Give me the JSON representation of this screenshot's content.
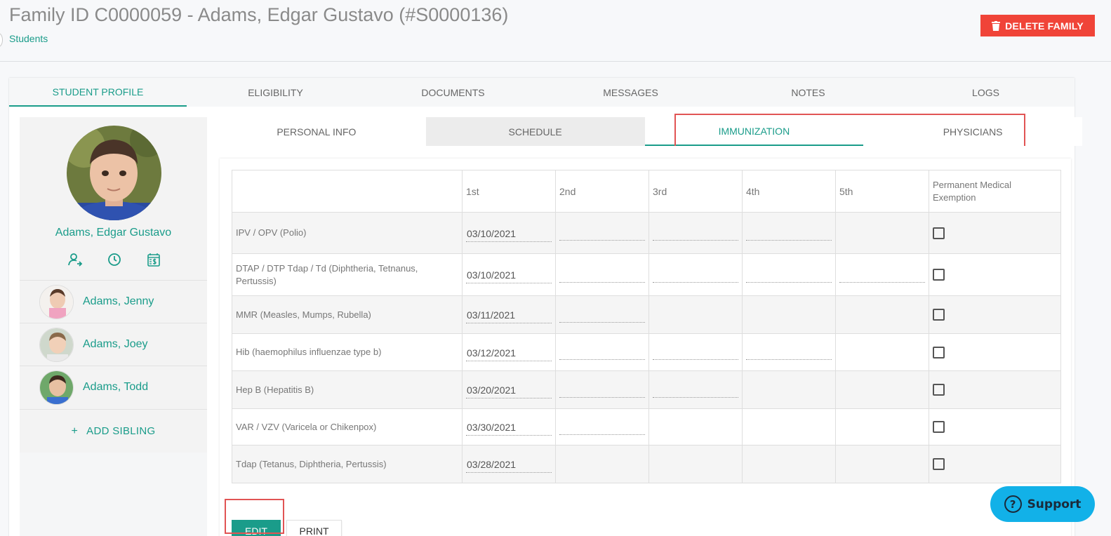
{
  "header": {
    "title": "Family ID C0000059 - Adams, Edgar Gustavo (#S0000136)",
    "breadcrumb": "Students",
    "delete_label": "DELETE FAMILY"
  },
  "main_tabs": [
    "STUDENT PROFILE",
    "ELIGIBILITY",
    "DOCUMENTS",
    "MESSAGES",
    "NOTES",
    "LOGS"
  ],
  "sidebar": {
    "student_name": "Adams, Edgar Gustavo",
    "siblings": [
      "Adams, Jenny",
      "Adams, Joey",
      "Adams, Todd"
    ],
    "add_sibling": "ADD SIBLING"
  },
  "sub_tabs": [
    "PERSONAL INFO",
    "SCHEDULE",
    "IMMUNIZATION",
    "PHYSICIANS"
  ],
  "table": {
    "headers": [
      "",
      "1st",
      "2nd",
      "3rd",
      "4th",
      "5th",
      "Permanent Medical Exemption"
    ],
    "rows": [
      {
        "vaccine": "IPV / OPV (Polio)",
        "dates": [
          "03/10/2021",
          "",
          "",
          "",
          ""
        ]
      },
      {
        "vaccine": "DTAP / DTP Tdap / Td (Diphtheria, Tetnanus, Pertussis)",
        "dates": [
          "03/10/2021",
          "",
          "",
          "",
          ""
        ]
      },
      {
        "vaccine": "MMR (Measles, Mumps, Rubella)",
        "dates": [
          "03/11/2021",
          "",
          "",
          "",
          ""
        ]
      },
      {
        "vaccine": "Hib (haemophilus influenzae type b)",
        "dates": [
          "03/12/2021",
          "",
          "",
          "",
          ""
        ]
      },
      {
        "vaccine": "Hep B (Hepatitis B)",
        "dates": [
          "03/20/2021",
          "",
          "",
          "",
          ""
        ]
      },
      {
        "vaccine": "VAR / VZV (Varicela or Chikenpox)",
        "dates": [
          "03/30/2021",
          "",
          "",
          "",
          ""
        ]
      },
      {
        "vaccine": "Tdap (Tetanus, Diphtheria, Pertussis)",
        "dates": [
          "03/28/2021",
          "",
          "",
          "",
          ""
        ]
      }
    ]
  },
  "actions": {
    "edit": "EDIT",
    "print": "PRINT"
  },
  "support": {
    "label": "Support"
  },
  "colors": {
    "accent": "#1a9c8a",
    "danger": "#f04438",
    "support": "#12b1e8",
    "highlight": "#e15454"
  }
}
